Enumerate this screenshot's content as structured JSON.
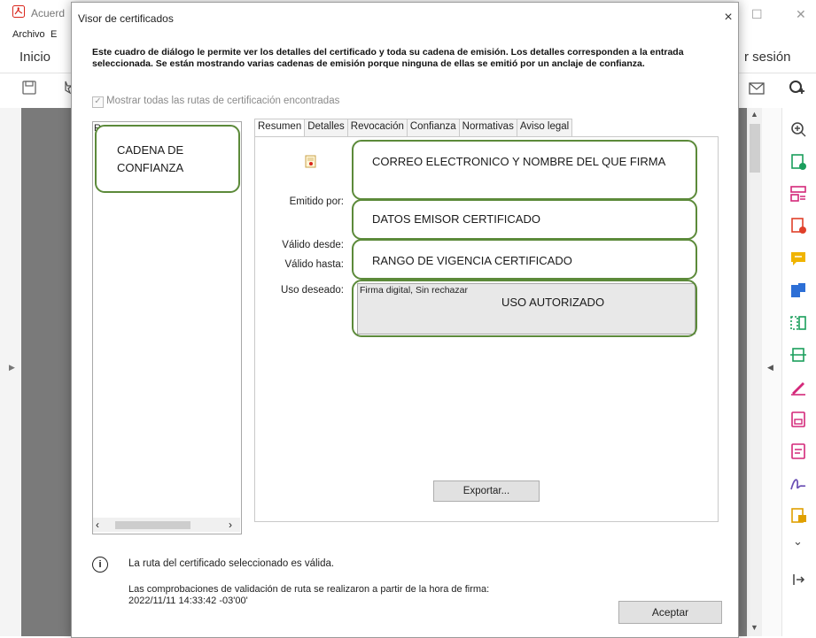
{
  "app": {
    "title_fragment": "Acuerd",
    "menu": [
      "Archivo",
      "E"
    ],
    "nav_home": "Inicio",
    "nav_session_fragment": "r sesión"
  },
  "dialog": {
    "title": "Visor de certificados",
    "close": "×",
    "description": "Este cuadro de diálogo le permite ver los detalles del certificado y toda su cadena de emisión. Los detalles corresponden a la entrada seleccionada. Se están mostrando varias cadenas de emisión porque ninguna de ellas se emitió por un anclaje de confianza.",
    "show_all_routes": "Mostrar todas las rutas de certificación encontradas",
    "tree_text": "R",
    "tabs": [
      "Resumen",
      "Detalles",
      "Revocación",
      "Confianza",
      "Normativas",
      "Aviso legal"
    ],
    "labels": {
      "issued_by": "Emitido por:",
      "valid_from": "Válido desde:",
      "valid_to": "Válido hasta:",
      "intended_use": "Uso deseado:"
    },
    "intended_use_value": "Firma digital, Sin rechazar",
    "export_button": "Exportar...",
    "path_valid_msg": "La ruta del certificado seleccionado es válida.",
    "path_check_msg": "Las comprobaciones de validación de ruta se realizaron a partir de la hora de firma:",
    "path_check_time": "2022/11/11 14:33:42 -03'00'",
    "accept_button": "Aceptar"
  },
  "annotations": {
    "chain": "CADENA DE CONFIANZA",
    "email_name": "CORREO ELECTRONICO Y NOMBRE DEL QUE FIRMA",
    "issuer": "DATOS EMISOR CERTIFICADO",
    "validity": "RANGO DE VIGENCIA CERTIFICADO",
    "usage": "USO AUTORIZADO"
  },
  "colors": {
    "annotation_border": "#5c8a3a",
    "acrobat_red": "#d9261c"
  }
}
